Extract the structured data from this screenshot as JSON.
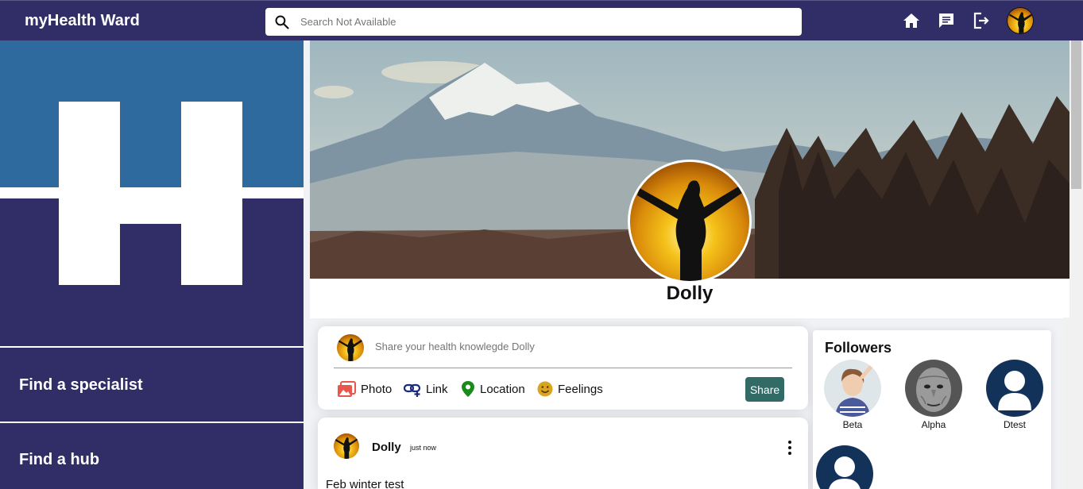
{
  "app": {
    "brand": "myHealth Ward"
  },
  "search": {
    "placeholder": "Search Not Available"
  },
  "topnav": {
    "icons": [
      "home-icon",
      "chat-icon",
      "logout-icon",
      "avatar"
    ]
  },
  "sidebar": {
    "items": [
      {
        "label": "Find a specialist"
      },
      {
        "label": "Find a hub"
      }
    ]
  },
  "profile": {
    "name": "Dolly"
  },
  "share": {
    "placeholder": "Share your health knowlegde Dolly",
    "options": [
      {
        "label": "Photo",
        "icon": "photo-icon",
        "color": "#e8574d"
      },
      {
        "label": "Link",
        "icon": "link-icon",
        "color": "#1a2a7a"
      },
      {
        "label": "Location",
        "icon": "location-icon",
        "color": "#1a8a1a"
      },
      {
        "label": "Feelings",
        "icon": "feelings-icon",
        "color": "#d9a520"
      }
    ],
    "button_label": "Share"
  },
  "post": {
    "author": "Dolly",
    "time": "just now",
    "text": "Feb winter test"
  },
  "followers": {
    "title": "Followers",
    "list": [
      {
        "name": "Beta"
      },
      {
        "name": "Alpha"
      },
      {
        "name": "Dtest"
      },
      {
        "name": ""
      }
    ]
  },
  "colors": {
    "topbar": "#312d66",
    "sidebar": "#312d66",
    "logo_blue": "#2f6a9f",
    "share_button": "#326b66",
    "default_avatar": "#12325a"
  }
}
